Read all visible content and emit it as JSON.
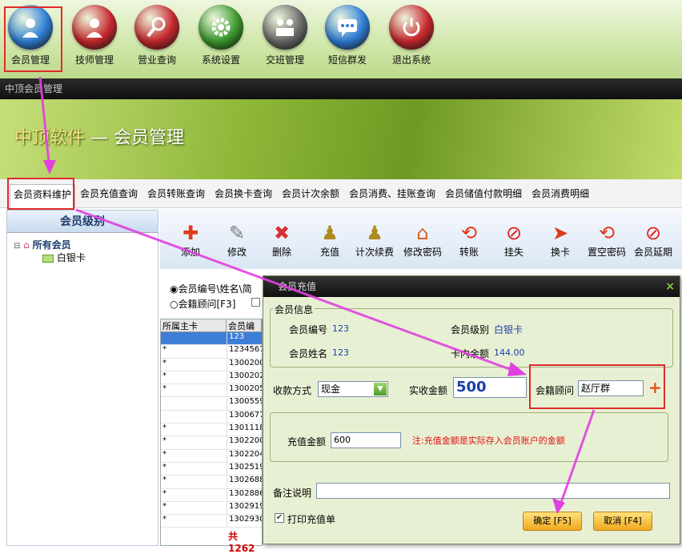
{
  "toolbar": {
    "items": [
      {
        "label": "会员管理",
        "icon": "member-icon",
        "color": "#2f7fd8"
      },
      {
        "label": "技师管理",
        "icon": "technician-icon",
        "color": "#c8282e"
      },
      {
        "label": "营业查询",
        "icon": "search-icon",
        "color": "#c8282e"
      },
      {
        "label": "系统设置",
        "icon": "gear-icon",
        "color": "#3c9a2e"
      },
      {
        "label": "交班管理",
        "icon": "handover-icon",
        "color": "#6a6a6a"
      },
      {
        "label": "短信群发",
        "icon": "sms-icon",
        "color": "#2f7fd8"
      },
      {
        "label": "退出系统",
        "icon": "power-icon",
        "color": "#c8282e"
      }
    ]
  },
  "window": {
    "title": "中顶会员管理"
  },
  "banner": {
    "brand": "中顶软件",
    "subtitle": " — 会员管理"
  },
  "tabs": [
    "会员资料维护",
    "会员充值查询",
    "会员转账查询",
    "会员换卡查询",
    "会员计次余额",
    "会员消费、挂账查询",
    "会员储值付款明细",
    "会员消费明细"
  ],
  "left_panel": {
    "title": "会员级别",
    "tree_root": "所有会员",
    "tree_child": "白银卡"
  },
  "actions": [
    {
      "label": "添加",
      "icon": "add-icon"
    },
    {
      "label": "修改",
      "icon": "edit-icon"
    },
    {
      "label": "删除",
      "icon": "delete-icon"
    },
    {
      "label": "充值",
      "icon": "recharge-icon"
    },
    {
      "label": "计次续费",
      "icon": "count-renew-icon"
    },
    {
      "label": "修改密码",
      "icon": "change-password-icon"
    },
    {
      "label": "转账",
      "icon": "transfer-icon"
    },
    {
      "label": "挂失",
      "icon": "report-loss-icon"
    },
    {
      "label": "换卡",
      "icon": "change-card-icon"
    },
    {
      "label": "置空密码",
      "icon": "clear-password-icon"
    },
    {
      "label": "会员延期",
      "icon": "extend-icon"
    }
  ],
  "search": {
    "option1": "会员编号\\姓名\\简",
    "option2": "会籍顾问[F3]"
  },
  "grid": {
    "headers": [
      "所属主卡",
      "会员编"
    ],
    "rows": [
      [
        "",
        "123"
      ],
      [
        "*",
        "1234567"
      ],
      [
        "*",
        "1300200"
      ],
      [
        "*",
        "1300202"
      ],
      [
        "*",
        "1300205"
      ],
      [
        "",
        "1300559"
      ],
      [
        "",
        "1300677"
      ],
      [
        "*",
        "1301118"
      ],
      [
        "*",
        "1302200"
      ],
      [
        "*",
        "1302204"
      ],
      [
        "*",
        "1302519"
      ],
      [
        "*",
        "1302688"
      ],
      [
        "*",
        "1302886"
      ],
      [
        "*",
        "1302919"
      ],
      [
        "*",
        "1302930"
      ]
    ],
    "footer": "共1262"
  },
  "dialog": {
    "title": "会员充值",
    "close": "×",
    "info_group": "会员信息",
    "member_no_label": "会员编号",
    "member_no": "123",
    "member_level_label": "会员级别",
    "member_level": "白银卡",
    "member_name_label": "会员姓名",
    "member_name": "123",
    "balance_label": "卡内余额",
    "balance": "144.00",
    "payment_label": "收款方式",
    "payment_value": "现金",
    "received_label": "实收金额",
    "received_value": "500",
    "advisor_label": "会籍顾问",
    "advisor_value": "赵厅群",
    "recharge_label": "充值金额",
    "recharge_value": "600",
    "note": "注:充值金额是实际存入会员账户的金额",
    "remark_label": "备注说明",
    "remark_value": "",
    "print_label": "打印充值单",
    "ok_button": "确定 [F5]",
    "cancel_button": "取消 [F4]"
  }
}
